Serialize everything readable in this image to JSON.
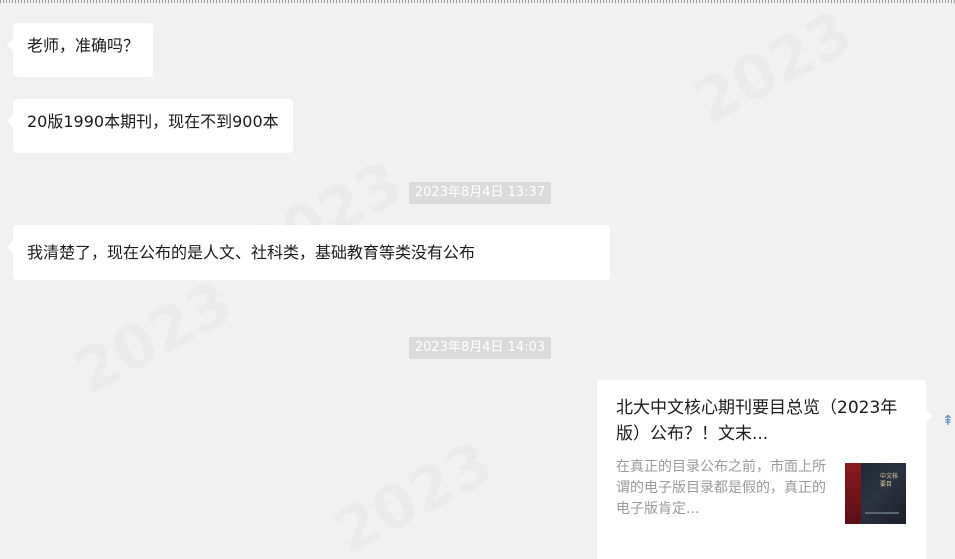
{
  "messages": [
    {
      "side": "left",
      "text": "老师，准确吗？"
    },
    {
      "side": "left",
      "text": "20版1990本期刊，现在不到900本"
    },
    {
      "side": "left",
      "text": "我清楚了，现在公布的是人文、社科类，基础教育等类没有公布"
    }
  ],
  "timestamps": [
    "2023年8月4日 13:37",
    "2023年8月4日 14:03"
  ],
  "link_card": {
    "side": "right",
    "title": "北大中文核心期刊要目总览（2023年版）公布？！文末...",
    "description": "在真正的目录公布之前，市面上所谓的电子版目录都是假的，真正的电子版肯定...",
    "thumbnail_icon": "book-cover-thumbnail",
    "thumb_text": "中文核 要目"
  },
  "colors": {
    "background": "#f1f1f1",
    "bubble": "#ffffff",
    "timestamp_bg": "#dadada",
    "timestamp_text": "#ffffff",
    "card_description": "#9a9a9a"
  }
}
